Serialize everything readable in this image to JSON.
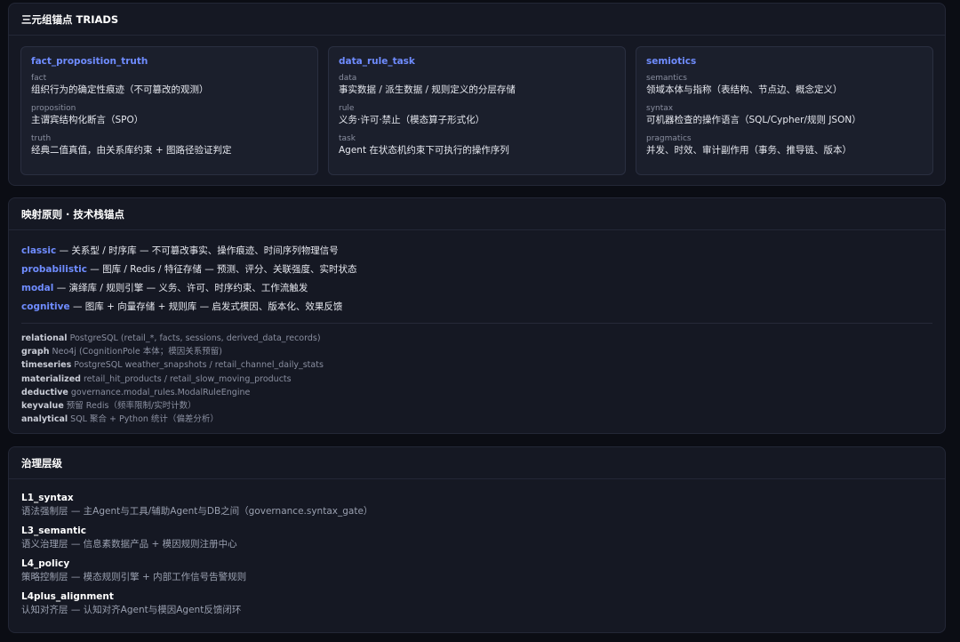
{
  "triads_panel": {
    "title": "三元组锚点 TRIADS",
    "cards": [
      {
        "title": "fact_proposition_truth",
        "items": [
          {
            "key": "fact",
            "value": "组织行为的确定性痕迹（不可篡改的观测）"
          },
          {
            "key": "proposition",
            "value": "主谓宾结构化断言（SPO）"
          },
          {
            "key": "truth",
            "value": "经典二值真值，由关系库约束 + 图路径验证判定"
          }
        ]
      },
      {
        "title": "data_rule_task",
        "items": [
          {
            "key": "data",
            "value": "事实数据 / 派生数据 / 规则定义的分层存储"
          },
          {
            "key": "rule",
            "value": "义务·许可·禁止（模态算子形式化）"
          },
          {
            "key": "task",
            "value": "Agent 在状态机约束下可执行的操作序列"
          }
        ]
      },
      {
        "title": "semiotics",
        "items": [
          {
            "key": "semantics",
            "value": "领域本体与指称（表结构、节点边、概念定义）"
          },
          {
            "key": "syntax",
            "value": "可机器检查的操作语言（SQL/Cypher/规则 JSON）"
          },
          {
            "key": "pragmatics",
            "value": "并发、时效、审计副作用（事务、推导链、版本）"
          }
        ]
      }
    ]
  },
  "mapping_panel": {
    "title": "映射原则 · 技术栈锚点",
    "principles": [
      {
        "key": "classic",
        "value": " — 关系型 / 时序库 — 不可篡改事实、操作痕迹、时间序列物理信号"
      },
      {
        "key": "probabilistic",
        "value": " — 图库 / Redis / 特征存储 — 预测、评分、关联强度、实时状态"
      },
      {
        "key": "modal",
        "value": " — 演绎库 / 规则引擎 — 义务、许可、时序约束、工作流触发"
      },
      {
        "key": "cognitive",
        "value": " — 图库 + 向量存储 + 规则库 — 启发式模因、版本化、效果反馈"
      }
    ],
    "tech": [
      {
        "key": "relational",
        "value": " PostgreSQL (retail_*, facts, sessions, derived_data_records)"
      },
      {
        "key": "graph",
        "value": " Neo4j (CognitionPole 本体；模因关系预留)"
      },
      {
        "key": "timeseries",
        "value": " PostgreSQL weather_snapshots / retail_channel_daily_stats"
      },
      {
        "key": "materialized",
        "value": " retail_hit_products / retail_slow_moving_products"
      },
      {
        "key": "deductive",
        "value": " governance.modal_rules.ModalRuleEngine"
      },
      {
        "key": "keyvalue",
        "value": " 预留 Redis（频率限制/实时计数）"
      },
      {
        "key": "analytical",
        "value": " SQL 聚合 + Python 统计（偏差分析）"
      }
    ]
  },
  "governance_panel": {
    "title": "治理层级",
    "levels": [
      {
        "name": "L1_syntax",
        "desc": "语法强制层 — 主Agent与工具/辅助Agent与DB之间（governance.syntax_gate）"
      },
      {
        "name": "L3_semantic",
        "desc": "语义治理层 — 信息素数据产品 + 模因规则注册中心"
      },
      {
        "name": "L4_policy",
        "desc": "策略控制层 — 模态规则引擎 + 内部工作信号告警规则"
      },
      {
        "name": "L4plus_alignment",
        "desc": "认知对齐层 — 认知对齐Agent与模因Agent反馈闭环"
      }
    ]
  }
}
